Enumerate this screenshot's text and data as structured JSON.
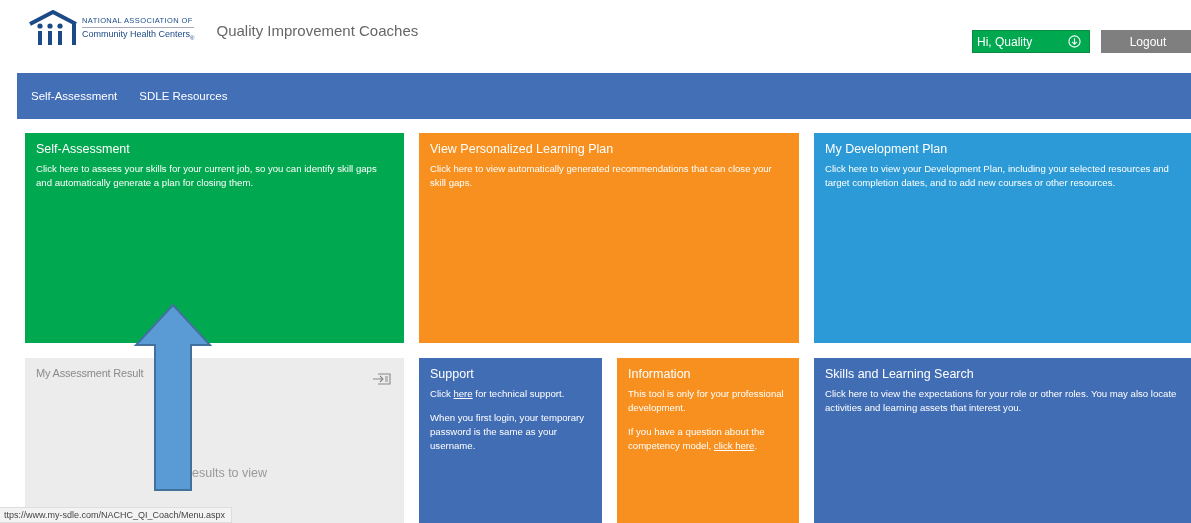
{
  "header": {
    "logo": {
      "line1": "NATIONAL ASSOCIATION OF",
      "line2": "Community Health Centers$_{®}$"
    },
    "app_title": "Quality Improvement Coaches",
    "user_menu": {
      "label": "Hi, Quality"
    },
    "logout_button": "Logout"
  },
  "nav": {
    "items": [
      {
        "label": "Self-Assessment"
      },
      {
        "label": "SDLE Resources"
      }
    ]
  },
  "tile_rows": [
    [
      {
        "kind": "text",
        "color": "#00a94f",
        "title": "Self-Assessment",
        "paragraphs": [
          {
            "text": "Click here to assess your skills for your current job, so you can identify skill gaps and automatically generate a plan for closing them."
          }
        ]
      },
      {
        "kind": "text",
        "color": "#f7901e",
        "title": "View Personalized Learning Plan",
        "paragraphs": [
          {
            "text": "Click here to view automatically generated recommendations that can close your skill gaps."
          }
        ]
      },
      {
        "kind": "text",
        "color": "#2b9ad6",
        "title": "My Development Plan",
        "paragraphs": [
          {
            "text": "Click here to view your Development Plan, including your selected resources and target completion dates, and to add new courses or other resources."
          }
        ]
      }
    ],
    [
      {
        "kind": "results",
        "color": "#ececec",
        "title": "My Assessment Result",
        "message": "esults to view"
      },
      {
        "kind": "text",
        "color": "#416db5",
        "title": "Support",
        "paragraphs": [
          {
            "text": "Click ",
            "link": "here",
            "after": " for technical support."
          },
          {
            "text": "When you first login, your temporary password is the same as your username."
          }
        ]
      },
      {
        "kind": "text",
        "color": "#f7901e",
        "title": "Information",
        "paragraphs": [
          {
            "text": "This tool is only for your professional development."
          },
          {
            "text": "If you have a question about the competency model, ",
            "link": "click here",
            "after": "."
          }
        ]
      },
      {
        "kind": "text",
        "color": "#416db5",
        "title": "Skills and Learning Search",
        "paragraphs": [
          {
            "text": "Click here to view the expectations for your role or other roles. You may also locate activities and learning assets that interest you."
          }
        ]
      }
    ]
  ],
  "status_url": "ttps://www.my-sdle.com/NACHC_QI_Coach/Menu.aspx"
}
